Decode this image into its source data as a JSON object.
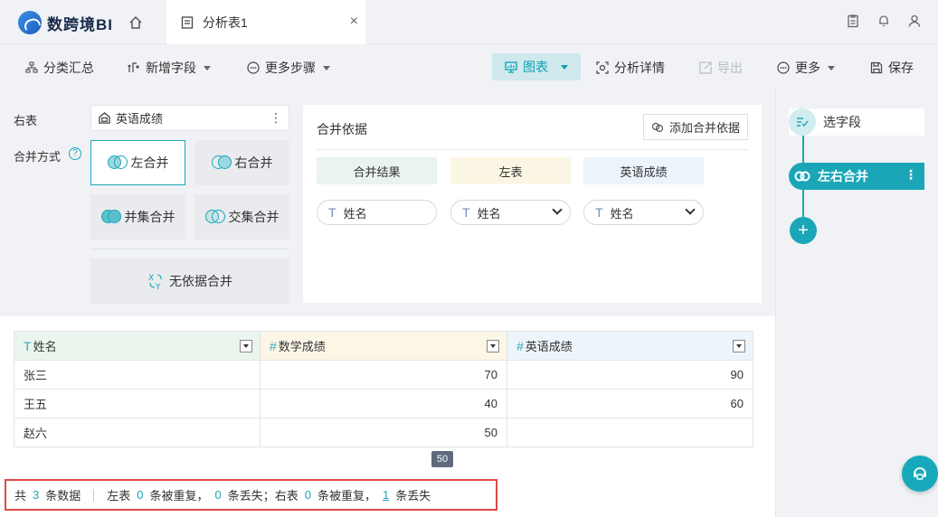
{
  "brand": {
    "name": "数跨境BI"
  },
  "tab": {
    "label": "分析表1",
    "close": "×"
  },
  "toolbar": {
    "group_summary": "分类汇总",
    "add_field": "新增字段",
    "more_steps": "更多步骤",
    "chart": "图表",
    "analysis_detail": "分析详情",
    "export": "导出",
    "more": "更多",
    "save": "保存"
  },
  "config": {
    "right_table_label": "右表",
    "right_table_value": "英语成绩",
    "merge_mode_label": "合并方式",
    "modes": [
      "左合并",
      "右合并",
      "并集合并",
      "交集合并"
    ],
    "no_basis_merge": "无依据合并",
    "help": "?"
  },
  "basis": {
    "title": "合并依据",
    "add_button": "添加合并依据",
    "columns": [
      "合并结果",
      "左表",
      "英语成绩"
    ],
    "fields": [
      "姓名",
      "姓名",
      "姓名"
    ],
    "type_glyph": "T"
  },
  "table": {
    "headers": [
      {
        "type": "T",
        "label": "姓名"
      },
      {
        "type": "#",
        "label": "数学成绩"
      },
      {
        "type": "#",
        "label": "英语成绩"
      }
    ],
    "rows": [
      [
        "张三",
        "70",
        "90"
      ],
      [
        "王五",
        "40",
        "60"
      ],
      [
        "赵六",
        "50",
        ""
      ]
    ],
    "hover_value": "50"
  },
  "summary": {
    "total_prefix": "共",
    "total": "3",
    "total_suffix": "条数据",
    "left_prefix": "左表",
    "left_dup": "0",
    "dup_suffix": "条被重复，",
    "left_lost": "0",
    "lost_suffix_1": "条丢失；右表",
    "right_dup": "0",
    "dup_suffix_2": "条被重复，",
    "right_lost": "1",
    "lost_suffix_2": "条丢失"
  },
  "flow": {
    "select_fields": "选字段",
    "left_right_merge": "左右合并",
    "add": "+"
  },
  "colors": {
    "accent": "#1aa6b7",
    "chart_active_bg": "#cfe9ed",
    "highlight_border": "#e04848"
  }
}
